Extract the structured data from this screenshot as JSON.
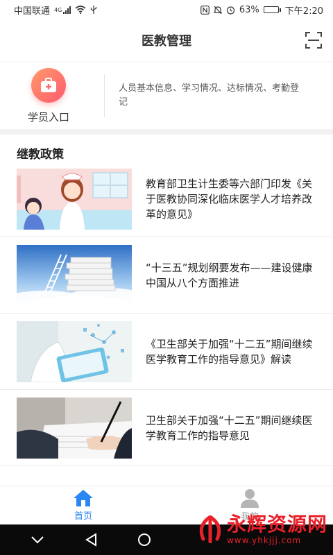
{
  "status_bar": {
    "carrier": "中国联通",
    "network": "4G",
    "battery": "63%",
    "battery_level": 0.63,
    "time": "下午2:20"
  },
  "header": {
    "title": "医教管理",
    "scan_icon": "scan-icon"
  },
  "entry": {
    "label": "学员入口",
    "description": "人员基本信息、学习情况、达标情况、考勤登记",
    "icon": "medical-kit-icon",
    "accent": "#ff6a6a"
  },
  "section": {
    "title": "继教政策"
  },
  "news": [
    {
      "title": "教育部卫生计生委等六部门印发《关于医教协同深化临床医学人才培养改革的意见》",
      "thumb": "nurse-illustration"
    },
    {
      "title": "“十三五”规划纲要发布——建设健康中国从八个方面推进",
      "thumb": "books-sky-image"
    },
    {
      "title": "《卫生部关于加强“十二五”期间继续医学教育工作的指导意见》解读",
      "thumb": "doctor-tablet-image"
    },
    {
      "title": "卫生部关于加强“十二五”期间继续医学教育工作的指导意见",
      "thumb": "signing-document-image"
    }
  ],
  "tabs": [
    {
      "label": "首页",
      "icon": "home-icon",
      "active": true
    },
    {
      "label": "我的",
      "icon": "person-icon",
      "active": false
    }
  ],
  "colors": {
    "active_tab": "#2a86f0",
    "inactive_tab": "#999999"
  },
  "watermark": {
    "text": "永辉资源网",
    "url": "www.yhkjjj.com"
  }
}
